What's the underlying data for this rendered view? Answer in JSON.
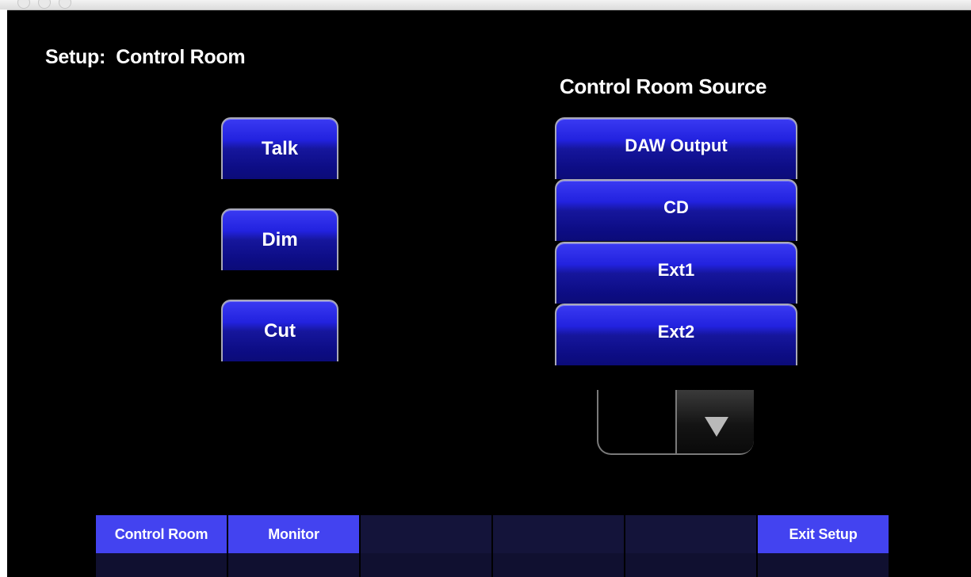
{
  "page": {
    "title": "Setup:  Control Room"
  },
  "controls": {
    "talk_label": "Talk",
    "dim_label": "Dim",
    "cut_label": "Cut"
  },
  "source": {
    "title": "Control Room Source",
    "items": [
      {
        "label": "DAW Output"
      },
      {
        "label": "CD"
      },
      {
        "label": "Ext1"
      },
      {
        "label": "Ext2"
      }
    ]
  },
  "tabs": [
    {
      "label": "Control Room",
      "active": true
    },
    {
      "label": "Monitor",
      "active": true
    },
    {
      "label": "",
      "active": false
    },
    {
      "label": "",
      "active": false
    },
    {
      "label": "",
      "active": false
    },
    {
      "label": "Exit Setup",
      "active": true
    }
  ],
  "colors": {
    "button_blue": "#2222df",
    "tab_active": "#4343f0",
    "tab_inactive": "#14143a",
    "background": "#000000"
  },
  "icons": {
    "scroll_down": "triangle-down-icon"
  }
}
